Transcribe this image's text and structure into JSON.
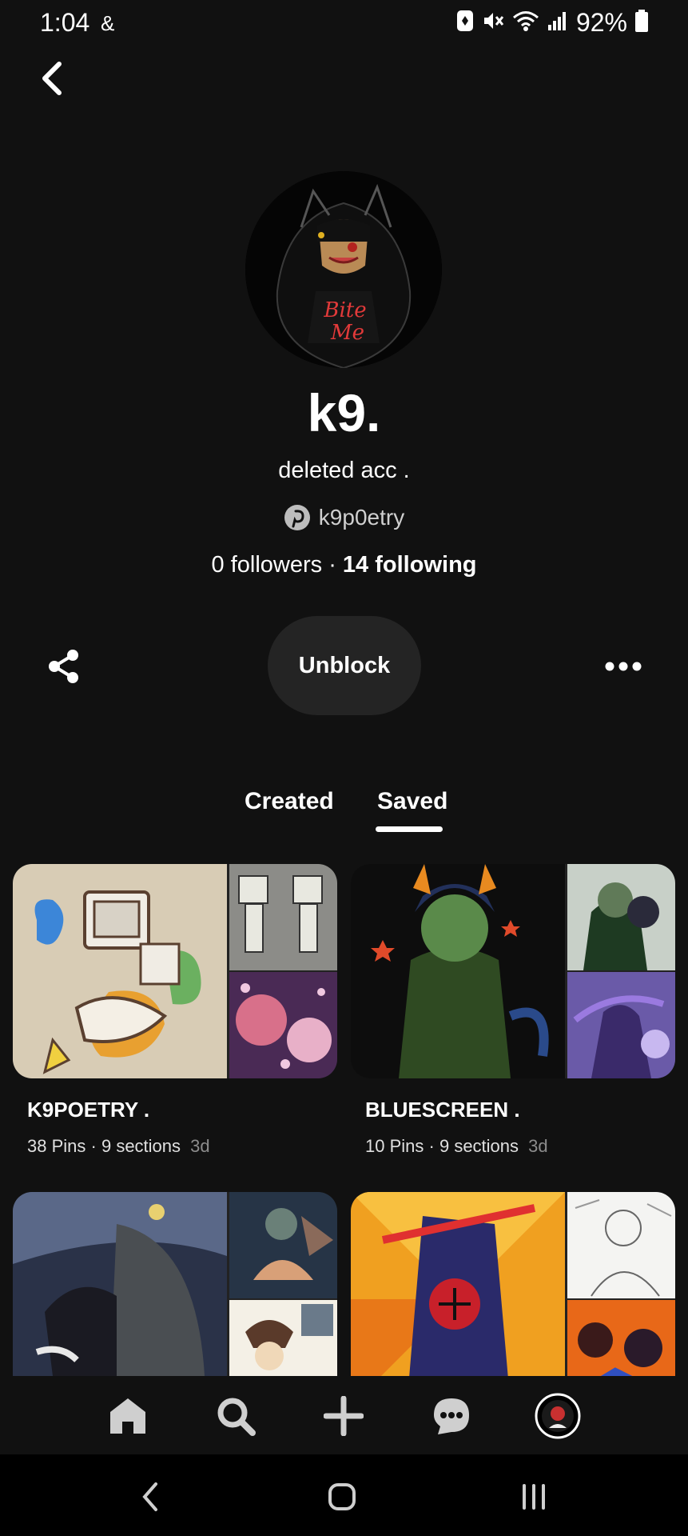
{
  "status_bar": {
    "time": "1:04",
    "extra": "&",
    "battery_percent": "92%"
  },
  "profile": {
    "display_name": "k9.",
    "bio": "deleted acc .",
    "username": "k9p0etry",
    "followers_count": "0",
    "followers_label": "followers",
    "separator": "·",
    "following_count": "14",
    "following_label": "following",
    "avatar_text": "Bite Me"
  },
  "actions": {
    "unblock_label": "Unblock"
  },
  "tabs": [
    {
      "label": "Created",
      "active": false
    },
    {
      "label": "Saved",
      "active": true
    }
  ],
  "boards": [
    {
      "title": "K9POETRY    .",
      "pins": "38 Pins",
      "sections": "9 sections",
      "age": "3d"
    },
    {
      "title": "BLUESCREEN    .",
      "pins": "10 Pins",
      "sections": "9 sections",
      "age": "3d"
    }
  ],
  "nav": {
    "items": [
      "home-icon",
      "search-icon",
      "create-icon",
      "messages-icon",
      "profile-avatar"
    ]
  },
  "colors": {
    "background": "#111111",
    "button_bg": "#242424",
    "text": "#ffffff",
    "muted": "#8c8c8c"
  }
}
